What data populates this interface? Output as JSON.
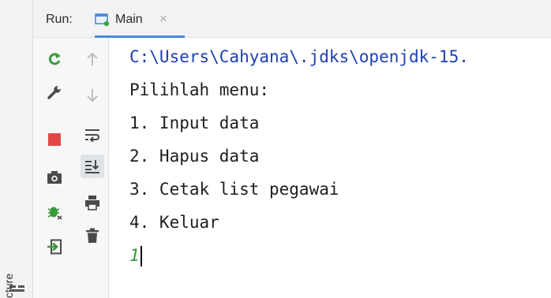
{
  "tool_window": {
    "run_label": "Run:",
    "tab": {
      "label": "Main",
      "close_glyph": "×",
      "icon": "run-config-icon"
    },
    "side_label": "cture"
  },
  "left_toolbar": [
    {
      "icon": "rerun-icon",
      "color": "#3a9a3a"
    },
    {
      "icon": "wrench-icon",
      "color": "#5a5a5a"
    },
    {
      "icon": "stop-icon",
      "color": "#e04848"
    },
    {
      "icon": "camera-icon",
      "color": "#5a5a5a"
    },
    {
      "icon": "debug-bug-icon",
      "color": "#3a9a3a"
    },
    {
      "icon": "exit-icon",
      "color": "#3a9a3a"
    }
  ],
  "right_toolbar": [
    {
      "icon": "up-arrow-icon"
    },
    {
      "icon": "down-arrow-icon"
    },
    {
      "icon": "soft-wrap-icon"
    },
    {
      "icon": "scroll-to-end-icon",
      "active": true
    },
    {
      "icon": "print-icon"
    },
    {
      "icon": "trash-icon"
    }
  ],
  "console": {
    "lines": [
      "C:\\Users\\Cahyana\\.jdks\\openjdk-15.",
      "Pilihlah menu:",
      "1. Input data",
      "2. Hapus data",
      "3. Cetak list pegawai",
      "4. Keluar"
    ],
    "input_value": "1"
  },
  "colors": {
    "path_text": "#1f3fb3",
    "input_text": "#2e9a2e",
    "accent_tab": "#4a89dc"
  }
}
